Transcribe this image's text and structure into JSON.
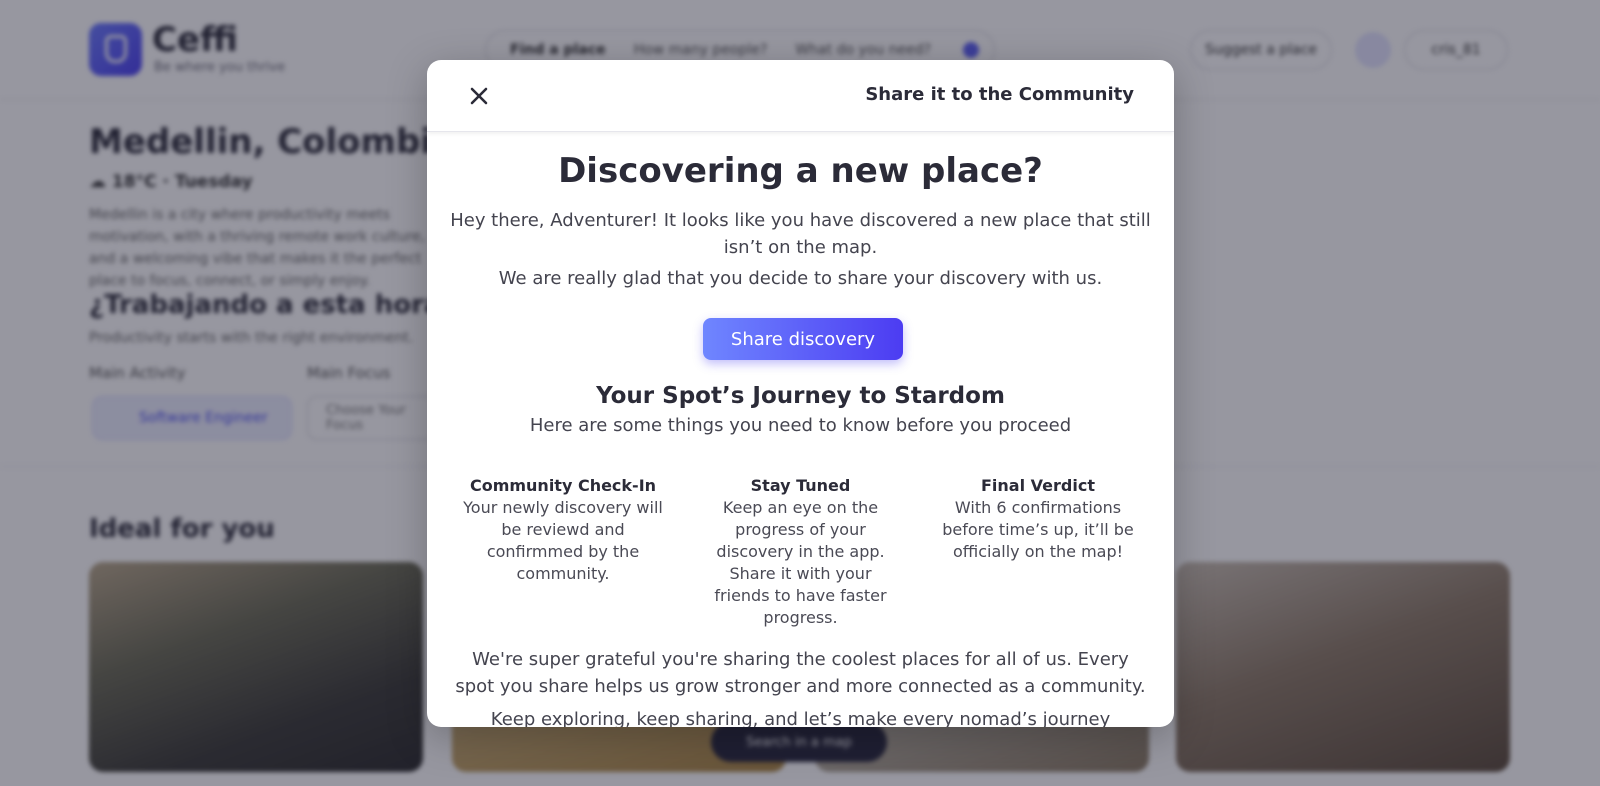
{
  "background": {
    "brand": {
      "name": "Ceffi",
      "tagline": "Be where you thrive"
    },
    "search": {
      "find": "Find a place",
      "people": "How many people?",
      "need": "What do you need?"
    },
    "header": {
      "suggest_label": "Suggest a place",
      "user_label": "cris_81"
    },
    "city": {
      "title": "Medellin, Colombia",
      "weather": "☁ 18°C · Tuesday",
      "description": "Medellin is a city where productivity meets motivation, with a thriving remote work culture, and a welcoming vibe that makes it the perfect place to focus, connect, or simply enjoy."
    },
    "work": {
      "title": "¿Trabajando a esta hora?",
      "subtitle": "Productivity starts with the right environment."
    },
    "activity": {
      "label": "Main Activity",
      "value": "Software Engineer"
    },
    "focus": {
      "label": "Main Focus",
      "placeholder": "Choose Your Focus"
    },
    "ideal_title": "Ideal for you",
    "map_button": "Search in a map"
  },
  "modal": {
    "title": "Share it to the Community",
    "heading": "Discovering a new place?",
    "intro": "Hey there, Adventurer! It looks like you have discovered a new place that still isn’t on the map.",
    "intro2": "We are really glad that you decide to share your discovery with us.",
    "share_button": "Share discovery",
    "journey_title": "Your Spot’s Journey to Stardom",
    "journey_subtitle": "Here are some things you need to know before you proceed",
    "steps": [
      {
        "title": "Community Check-In",
        "text": "Your newly discovery will be reviewd and confirmmed by the community."
      },
      {
        "title": "Stay Tuned",
        "text": "Keep an eye on the progress of your discovery in the app. Share it with your friends to have faster progress."
      },
      {
        "title": "Final Verdict",
        "text": "With 6 confirmations before time’s up, it’ll be officially on the map!"
      }
    ],
    "thanks": "We're super grateful you're sharing the coolest places for all of us. Every spot you share helps us grow stronger and more connected as a community.",
    "keep_exploring": "Keep exploring, keep sharing, and let’s make every nomad’s journey amazing."
  },
  "colors": {
    "accent": "#5b5ff5",
    "button_gradient_start": "#6f86ff",
    "button_gradient_end": "#4c3cf2",
    "overlay": "rgba(24,24,44,0.45)",
    "text_dark": "#2b2b38"
  },
  "icons": {
    "close": "close-icon",
    "logo": "logo-icon",
    "search": "search-icon",
    "heart": "heart-icon",
    "user": "user-icon",
    "cloud": "cloud-icon"
  }
}
